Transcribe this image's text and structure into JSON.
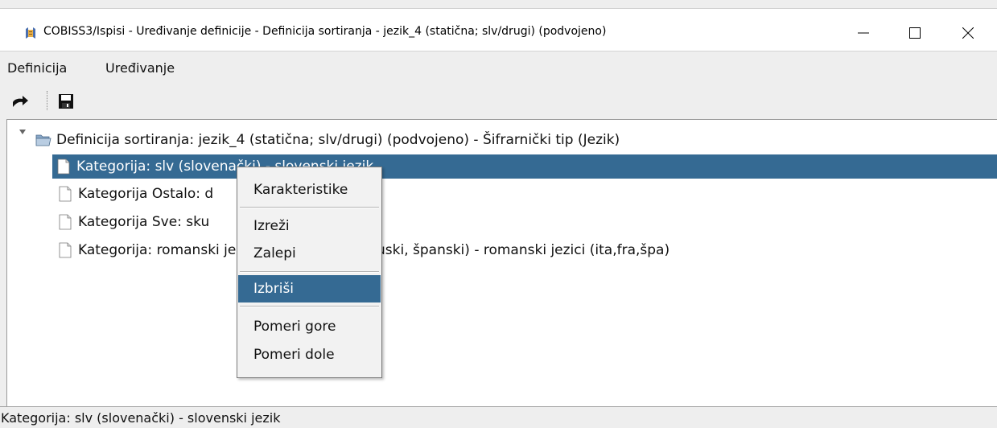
{
  "window": {
    "title": "COBISS3/Ispisi - Uređivanje definicije - Definicija sortiranja - jezik_4 (statična; slv/drugi) (podvojeno)",
    "app_icon": "cobiss-app-icon",
    "controls": {
      "minimize": "minimize-icon",
      "maximize": "maximize-icon",
      "close": "close-icon"
    }
  },
  "menubar": {
    "items": [
      "Definicija",
      "Uređivanje"
    ]
  },
  "toolbar": {
    "buttons": [
      {
        "icon": "exit-icon"
      },
      {
        "icon": "save-icon"
      }
    ]
  },
  "tree": {
    "root": {
      "label": "Definicija sortiranja: jezik_4 (statična; slv/drugi) (podvojeno) - Šifrarnički tip (Jezik)",
      "icon": "open-folder-icon",
      "expanded": true
    },
    "children": [
      {
        "label": "Kategorija: slv (slovenački) - slovenski jezik",
        "icon": "document-icon",
        "selected": true
      },
      {
        "label": "Kategorija Ostalo: d",
        "icon": "document-icon",
        "selected": false
      },
      {
        "label": "Kategorija Sve: sku",
        "icon": "document-icon",
        "selected": false
      },
      {
        "label": "Kategorija: romanski jezici (italijanski, francuski, španski) - romanski jezici (ita,fra,špa)",
        "icon": "document-icon",
        "selected": false
      }
    ]
  },
  "context_menu": {
    "items": [
      "Karakteristike",
      "Izreži",
      "Zalepi",
      "Izbriši",
      "Pomeri gore",
      "Pomeri dole"
    ],
    "highlighted": "Izbriši"
  },
  "statusbar": {
    "text": "Kategorija: slv (slovenački) - slovenski jezik"
  },
  "colors": {
    "selection": "#356a93",
    "background": "#eeeeee"
  }
}
